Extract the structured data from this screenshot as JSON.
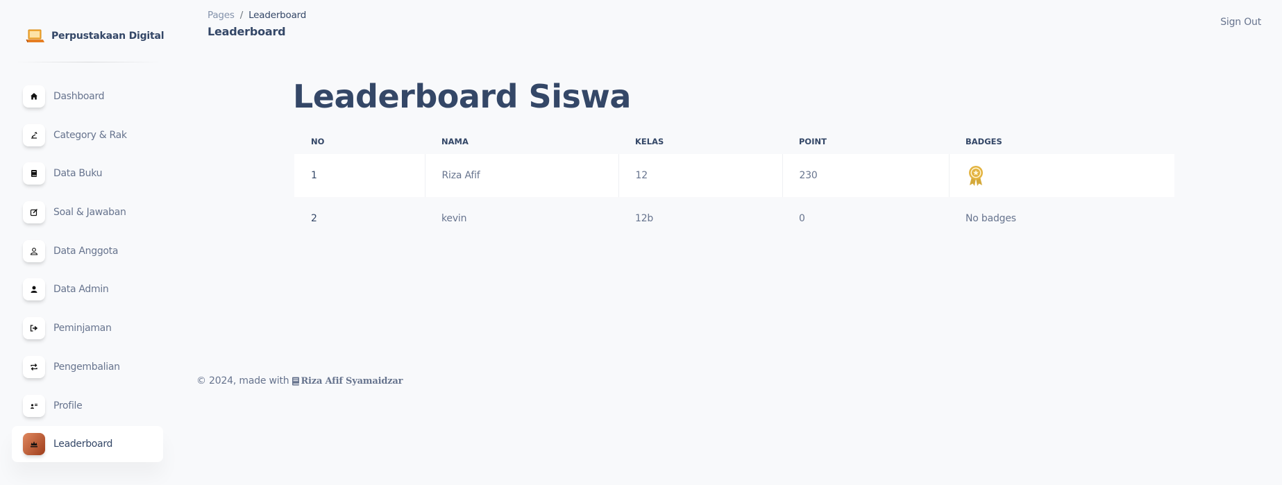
{
  "brand": {
    "name": "Perpustakaan Digital"
  },
  "sidebar": {
    "items": [
      {
        "label": "Dashboard",
        "icon": "home-icon"
      },
      {
        "label": "Category & Rak",
        "icon": "category-icon"
      },
      {
        "label": "Data Buku",
        "icon": "book-icon"
      },
      {
        "label": "Soal & Jawaban",
        "icon": "edit-icon"
      },
      {
        "label": "Data Anggota",
        "icon": "user-outline-icon"
      },
      {
        "label": "Data Admin",
        "icon": "user-icon"
      },
      {
        "label": "Peminjaman",
        "icon": "sign-out-icon"
      },
      {
        "label": "Pengembalian",
        "icon": "return-icon"
      },
      {
        "label": "Profile",
        "icon": "profile-card-icon"
      },
      {
        "label": "Leaderboard",
        "icon": "crown-icon",
        "active": true
      }
    ]
  },
  "header": {
    "breadcrumb_parent": "Pages",
    "breadcrumb_separator": "/",
    "breadcrumb_current": "Leaderboard",
    "page_title": "Leaderboard",
    "signout_label": "Sign Out"
  },
  "main": {
    "title": "Leaderboard Siswa",
    "table": {
      "headers": [
        "NO",
        "NAMA",
        "KELAS",
        "POINT",
        "BADGES"
      ],
      "rows": [
        {
          "no": "1",
          "nama": "Riza Afif",
          "kelas": "12",
          "point": "230",
          "badges": "",
          "badge_icon": "award-medal-icon"
        },
        {
          "no": "2",
          "nama": "kevin",
          "kelas": "12b",
          "point": "0",
          "badges": "No badges"
        }
      ]
    }
  },
  "footer": {
    "text": "© 2024, made with",
    "author": "Riza Afif Syamaidzar"
  },
  "colors": {
    "accent_gradient_start": "#9e3d1b",
    "accent_gradient_end": "#e0885f",
    "heading": "#344767",
    "muted": "#67748e",
    "badge_gold": "#e3b341"
  }
}
